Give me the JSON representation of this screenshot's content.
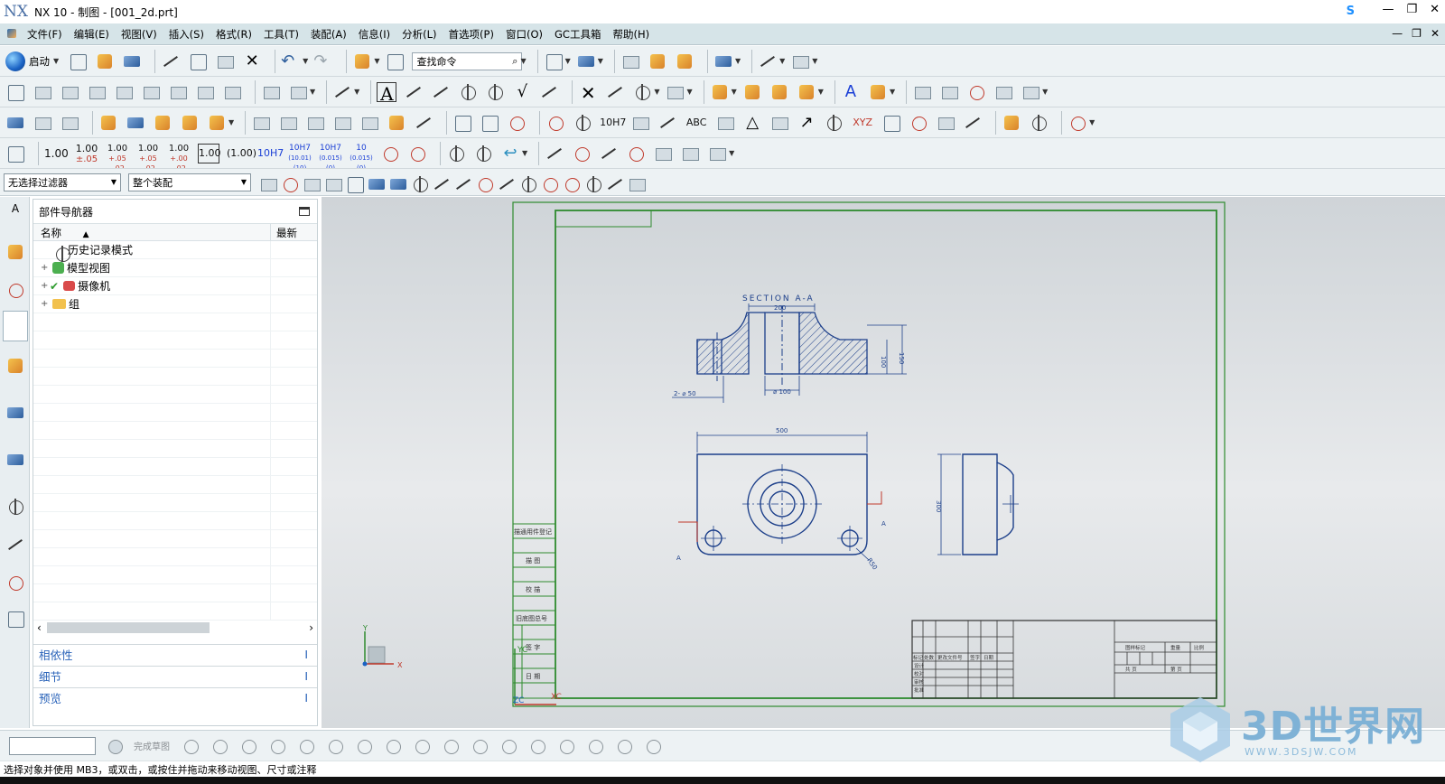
{
  "window": {
    "logo": "NX",
    "title": "NX 10 - 制图 - [001_2d.prt]",
    "skype_label": "S",
    "controls": [
      "—",
      "❐",
      "✕"
    ]
  },
  "menu": {
    "items": [
      "文件(F)",
      "编辑(E)",
      "视图(V)",
      "插入(S)",
      "格式(R)",
      "工具(T)",
      "装配(A)",
      "信息(I)",
      "分析(L)",
      "首选项(P)",
      "窗口(O)",
      "GC工具箱",
      "帮助(H)"
    ],
    "right_controls": [
      "—",
      "❐",
      "✕"
    ]
  },
  "toolbar1": {
    "launch_label": "启动",
    "search_placeholder": "查找命令"
  },
  "dim_toolbar": {
    "labels": [
      "1.00",
      "1.00\n±.05",
      "1.00\n+.05\n-.02",
      "1.00\n+.05\n-.02",
      "1.00\n+.00\n-.02",
      "1.00",
      "(1.00)",
      "10H7",
      "10H7\n(10.01)\n(10)",
      "10H7\n(0.015)\n(0)",
      "10\n(0.015)\n(0)"
    ]
  },
  "filter": {
    "selection_filter": "无选择过滤器",
    "scope": "整个装配"
  },
  "navigator": {
    "title": "部件导航器",
    "col_name": "名称",
    "col_latest": "最新",
    "rows": [
      {
        "expand": "",
        "label": "历史记录模式"
      },
      {
        "expand": "+",
        "label": "模型视图"
      },
      {
        "expand": "+",
        "label": "摄像机"
      },
      {
        "expand": "+",
        "label": "组"
      }
    ],
    "sections": [
      {
        "label": "相依性",
        "marker": "I"
      },
      {
        "label": "细节",
        "marker": "I"
      },
      {
        "label": "预览",
        "marker": "I"
      }
    ]
  },
  "drawing": {
    "section_label": "SECTION  A-A",
    "dims": {
      "top_width": "200",
      "right_height_outer": "150",
      "right_height_inner": "100",
      "hole_dia": "⌀ 100",
      "left_hole": "2- ⌀ 50",
      "plan_width": "500",
      "side_height": "300",
      "radius": "R50"
    },
    "section_marks": [
      "A",
      "A"
    ],
    "left_table": [
      "描通用件登记",
      "描   图",
      "校   描",
      "旧底图总号",
      "签   字",
      "日   期"
    ],
    "title_block": {
      "row_labels": [
        "设计",
        "校对",
        "审核",
        "批准"
      ],
      "header_cols": [
        "标记",
        "处数",
        "更改文件号",
        "签字",
        "日期"
      ],
      "right_header": [
        "图样标记",
        "重量",
        "比例"
      ],
      "right_footer": [
        "共   页",
        "第   页"
      ]
    },
    "axes": {
      "x": "X",
      "y": "Y",
      "xc": "XC",
      "yc": "YC",
      "zc": "ZC"
    }
  },
  "sketchbar": {
    "finish_label": "完成草图"
  },
  "status": {
    "message": "选择对象并使用 MB3，或双击，或按住并拖动来移动视图、尺寸或注释"
  },
  "watermark": {
    "brand": "3D世界网",
    "url": "WWW.3DSJW.COM"
  },
  "colors": {
    "drawing_line": "#1c3f8a",
    "border_green": "#2e8b2e",
    "link_blue": "#2a63b9"
  }
}
